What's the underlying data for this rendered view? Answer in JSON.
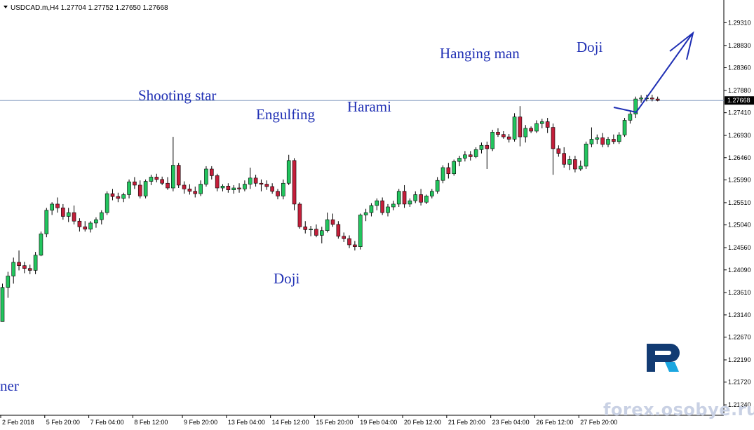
{
  "chart_data": {
    "type": "candlestick",
    "symbol_header": "USDCAD.m,H4  1.27704 1.27752 1.27650 1.27668",
    "current_price": 1.27668,
    "current_price_label": "1.27668",
    "ylim": [
      1.2102,
      1.2979
    ],
    "grid": false,
    "y_ticks": [
      "1.29310",
      "1.28830",
      "1.28360",
      "1.27880",
      "1.27410",
      "1.26930",
      "1.26460",
      "1.25990",
      "1.25510",
      "1.25040",
      "1.24560",
      "1.24090",
      "1.23610",
      "1.23140",
      "1.22670",
      "1.22190",
      "1.21720",
      "1.21240"
    ],
    "x_ticks": [
      "2 Feb 2018",
      "5 Feb 20:00",
      "7 Feb 04:00",
      "8 Feb 12:00",
      "9 Feb 20:00",
      "13 Feb 04:00",
      "14 Feb 12:00",
      "15 Feb 20:00",
      "19 Feb 04:00",
      "20 Feb 12:00",
      "21 Feb 20:00",
      "23 Feb 04:00",
      "26 Feb 12:00",
      "27 Feb 20:00"
    ],
    "candles": [
      [
        1.23,
        1.238,
        1.23,
        1.2372
      ],
      [
        1.2372,
        1.2405,
        1.235,
        1.2396
      ],
      [
        1.2396,
        1.2435,
        1.238,
        1.2425
      ],
      [
        1.2425,
        1.245,
        1.2408,
        1.2418
      ],
      [
        1.2418,
        1.2426,
        1.2402,
        1.2412
      ],
      [
        1.2412,
        1.242,
        1.24,
        1.2408
      ],
      [
        1.2408,
        1.2447,
        1.24,
        1.244
      ],
      [
        1.244,
        1.249,
        1.2438,
        1.2485
      ],
      [
        1.2485,
        1.254,
        1.2478,
        1.2535
      ],
      [
        1.2535,
        1.2552,
        1.2525,
        1.2548
      ],
      [
        1.2548,
        1.2562,
        1.253,
        1.254
      ],
      [
        1.254,
        1.2548,
        1.2515,
        1.2522
      ],
      [
        1.2522,
        1.254,
        1.251,
        1.253
      ],
      [
        1.253,
        1.2545,
        1.2505,
        1.2512
      ],
      [
        1.2512,
        1.2518,
        1.249,
        1.25
      ],
      [
        1.25,
        1.2512,
        1.249,
        1.2495
      ],
      [
        1.2495,
        1.2512,
        1.2488,
        1.2508
      ],
      [
        1.2508,
        1.252,
        1.2498,
        1.2515
      ],
      [
        1.2515,
        1.2535,
        1.2505,
        1.253
      ],
      [
        1.253,
        1.2575,
        1.2525,
        1.257
      ],
      [
        1.257,
        1.258,
        1.2556,
        1.2564
      ],
      [
        1.2564,
        1.2572,
        1.2552,
        1.256
      ],
      [
        1.256,
        1.2572,
        1.2552,
        1.2568
      ],
      [
        1.2568,
        1.26,
        1.256,
        1.2595
      ],
      [
        1.2595,
        1.2605,
        1.258,
        1.2588
      ],
      [
        1.2588,
        1.2598,
        1.256,
        1.2565
      ],
      [
        1.2565,
        1.26,
        1.256,
        1.2596
      ],
      [
        1.2596,
        1.261,
        1.2588,
        1.2605
      ],
      [
        1.2605,
        1.2612,
        1.2594,
        1.26
      ],
      [
        1.26,
        1.2606,
        1.2588,
        1.2592
      ],
      [
        1.2592,
        1.2605,
        1.2578,
        1.2582
      ],
      [
        1.2582,
        1.269,
        1.2575,
        1.263
      ],
      [
        1.263,
        1.2635,
        1.2582,
        1.2588
      ],
      [
        1.2588,
        1.2596,
        1.257,
        1.258
      ],
      [
        1.258,
        1.259,
        1.2568,
        1.2575
      ],
      [
        1.2575,
        1.2585,
        1.2562,
        1.257
      ],
      [
        1.257,
        1.2598,
        1.2565,
        1.259
      ],
      [
        1.259,
        1.2628,
        1.2585,
        1.2622
      ],
      [
        1.2622,
        1.2628,
        1.26,
        1.2608
      ],
      [
        1.2608,
        1.2612,
        1.2575,
        1.2582
      ],
      [
        1.2582,
        1.259,
        1.2575,
        1.2586
      ],
      [
        1.2586,
        1.2592,
        1.2572,
        1.2578
      ],
      [
        1.2578,
        1.2588,
        1.257,
        1.2582
      ],
      [
        1.2582,
        1.2592,
        1.2572,
        1.258
      ],
      [
        1.258,
        1.2598,
        1.2575,
        1.259
      ],
      [
        1.259,
        1.2625,
        1.258,
        1.2603
      ],
      [
        1.2603,
        1.261,
        1.2585,
        1.2592
      ],
      [
        1.2592,
        1.26,
        1.2575,
        1.259
      ],
      [
        1.259,
        1.2598,
        1.2578,
        1.2585
      ],
      [
        1.2585,
        1.2592,
        1.257,
        1.2575
      ],
      [
        1.2575,
        1.258,
        1.2558,
        1.2565
      ],
      [
        1.2565,
        1.26,
        1.2558,
        1.2592
      ],
      [
        1.2592,
        1.2652,
        1.2588,
        1.264
      ],
      [
        1.264,
        1.2645,
        1.2535,
        1.2548
      ],
      [
        1.2548,
        1.2552,
        1.2496,
        1.25
      ],
      [
        1.25,
        1.2512,
        1.2486,
        1.2494
      ],
      [
        1.2494,
        1.2502,
        1.248,
        1.2495
      ],
      [
        1.2495,
        1.2505,
        1.2478,
        1.2482
      ],
      [
        1.2482,
        1.25,
        1.2465,
        1.2492
      ],
      [
        1.2492,
        1.253,
        1.2488,
        1.2515
      ],
      [
        1.2515,
        1.2528,
        1.25,
        1.2505
      ],
      [
        1.2505,
        1.2512,
        1.2475,
        1.248
      ],
      [
        1.248,
        1.2488,
        1.2468,
        1.2475
      ],
      [
        1.2475,
        1.2482,
        1.2455,
        1.2462
      ],
      [
        1.2462,
        1.247,
        1.245,
        1.2458
      ],
      [
        1.2458,
        1.2528,
        1.2452,
        1.2525
      ],
      [
        1.2525,
        1.2538,
        1.2512,
        1.253
      ],
      [
        1.253,
        1.255,
        1.2522,
        1.2545
      ],
      [
        1.2545,
        1.256,
        1.2535,
        1.2555
      ],
      [
        1.2555,
        1.2562,
        1.2525,
        1.253
      ],
      [
        1.253,
        1.2548,
        1.2522,
        1.2542
      ],
      [
        1.2542,
        1.2555,
        1.2535,
        1.2548
      ],
      [
        1.2548,
        1.258,
        1.2542,
        1.2575
      ],
      [
        1.2575,
        1.2588,
        1.254,
        1.2548
      ],
      [
        1.2548,
        1.256,
        1.2542,
        1.2555
      ],
      [
        1.2555,
        1.2575,
        1.255,
        1.2568
      ],
      [
        1.2568,
        1.258,
        1.2545,
        1.2552
      ],
      [
        1.2552,
        1.2568,
        1.2548,
        1.2565
      ],
      [
        1.2565,
        1.258,
        1.256,
        1.2575
      ],
      [
        1.2575,
        1.2605,
        1.257,
        1.2598
      ],
      [
        1.2598,
        1.263,
        1.2592,
        1.2625
      ],
      [
        1.2625,
        1.2635,
        1.2602,
        1.2612
      ],
      [
        1.2612,
        1.2642,
        1.2608,
        1.2638
      ],
      [
        1.2638,
        1.265,
        1.2628,
        1.2645
      ],
      [
        1.2645,
        1.266,
        1.2638,
        1.2652
      ],
      [
        1.2652,
        1.266,
        1.264,
        1.2648
      ],
      [
        1.2648,
        1.2668,
        1.2645,
        1.2663
      ],
      [
        1.2663,
        1.2678,
        1.2655,
        1.2672
      ],
      [
        1.2672,
        1.268,
        1.2622,
        1.2665
      ],
      [
        1.2665,
        1.2705,
        1.266,
        1.27
      ],
      [
        1.27,
        1.2708,
        1.269,
        1.2695
      ],
      [
        1.2695,
        1.2702,
        1.2686,
        1.269
      ],
      [
        1.269,
        1.2696,
        1.2678,
        1.2685
      ],
      [
        1.2685,
        1.274,
        1.268,
        1.2732
      ],
      [
        1.2732,
        1.2755,
        1.267,
        1.269
      ],
      [
        1.269,
        1.2715,
        1.2678,
        1.2708
      ],
      [
        1.2708,
        1.2712,
        1.2698,
        1.2702
      ],
      [
        1.2702,
        1.2725,
        1.2698,
        1.2718
      ],
      [
        1.2718,
        1.2728,
        1.2708,
        1.2722
      ],
      [
        1.2722,
        1.273,
        1.2698,
        1.271
      ],
      [
        1.271,
        1.2718,
        1.261,
        1.2665
      ],
      [
        1.2665,
        1.2672,
        1.2648,
        1.2655
      ],
      [
        1.2655,
        1.2668,
        1.2625,
        1.2632
      ],
      [
        1.2632,
        1.265,
        1.262,
        1.2642
      ],
      [
        1.2642,
        1.265,
        1.2615,
        1.2622
      ],
      [
        1.2622,
        1.264,
        1.2618,
        1.2628
      ],
      [
        1.2628,
        1.268,
        1.2622,
        1.2675
      ],
      [
        1.2675,
        1.271,
        1.2668,
        1.2685
      ],
      [
        1.2685,
        1.2695,
        1.2675,
        1.2688
      ],
      [
        1.2688,
        1.2698,
        1.2668,
        1.2674
      ],
      [
        1.2674,
        1.269,
        1.2668,
        1.2685
      ],
      [
        1.2685,
        1.2695,
        1.2675,
        1.268
      ],
      [
        1.268,
        1.27,
        1.2675,
        1.2694
      ],
      [
        1.2694,
        1.273,
        1.269,
        1.2725
      ],
      [
        1.2725,
        1.2745,
        1.2718,
        1.2738
      ],
      [
        1.2738,
        1.2775,
        1.273,
        1.277
      ],
      [
        1.277,
        1.2778,
        1.2762,
        1.2772
      ],
      [
        1.2772,
        1.2779,
        1.2765,
        1.2772
      ],
      [
        1.2772,
        1.2779,
        1.2765,
        1.277
      ],
      [
        1.277,
        1.2775,
        1.2765,
        1.2767
      ]
    ],
    "annotations": [
      {
        "text": "Shooting star"
      },
      {
        "text": "Engulfing"
      },
      {
        "text": "Harami"
      },
      {
        "text": "Hanging man"
      },
      {
        "text": "Doji"
      },
      {
        "text": "Doji"
      },
      {
        "text": "ner"
      }
    ],
    "colors": {
      "bull": "#22c55e",
      "bear": "#c41e3a",
      "text": "#1f2fb4",
      "price_line": "#8aa0c3",
      "axis": "#000000"
    }
  },
  "watermark": {
    "site": "forex.osobye.ru",
    "logo": "roboforex-r-icon"
  }
}
